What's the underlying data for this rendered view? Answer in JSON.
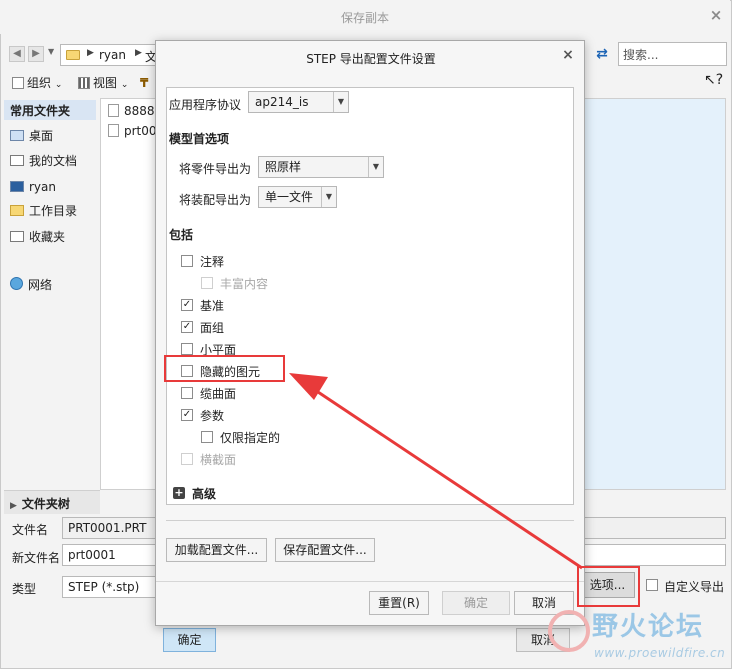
{
  "background_window": {
    "title": "保存副本",
    "close_glyph": "×",
    "address": {
      "user": "ryan",
      "partial": "文"
    },
    "search_placeholder": "搜索...",
    "toolbar": {
      "organize": "组织",
      "view": "视图"
    },
    "sidebar": {
      "header": "常用文件夹",
      "items": [
        {
          "label": "桌面",
          "icon": "desktop-icon"
        },
        {
          "label": "我的文档",
          "icon": "documents-icon"
        },
        {
          "label": "ryan",
          "icon": "computer-icon"
        },
        {
          "label": "工作目录",
          "icon": "working-directory-icon"
        },
        {
          "label": "收藏夹",
          "icon": "favorites-icon"
        },
        {
          "label": "网络",
          "icon": "network-icon"
        }
      ]
    },
    "files": [
      "8888",
      "prt00"
    ],
    "folder_tree": "文件夹树",
    "form": {
      "filename_label": "文件名",
      "filename_value": "PRT0001.PRT",
      "newname_label": "新文件名",
      "newname_value": "prt0001",
      "type_label": "类型",
      "type_value": "STEP (*.stp)"
    },
    "ok_button": "确定",
    "cancel_button": "取消",
    "options_button": "选项...",
    "custom_export_label": "自定义导出"
  },
  "dialog": {
    "title": "STEP 导出配置文件设置",
    "close_glyph": "×",
    "protocol_label": "应用程序协议",
    "protocol_value": "ap214_is",
    "model_prefs_header": "模型首选项",
    "part_export_label": "将零件导出为",
    "part_export_value": "照原样",
    "assembly_export_label": "将装配导出为",
    "assembly_export_value": "单一文件",
    "include_header": "包括",
    "checkboxes": [
      {
        "label": "注释",
        "checked": false,
        "disabled": false
      },
      {
        "label": "丰富内容",
        "checked": false,
        "disabled": true
      },
      {
        "label": "基准",
        "checked": true,
        "disabled": false
      },
      {
        "label": "面组",
        "checked": true,
        "disabled": false
      },
      {
        "label": "小平面",
        "checked": false,
        "disabled": false
      },
      {
        "label": "隐藏的图元",
        "checked": false,
        "disabled": false
      },
      {
        "label": "缆曲面",
        "checked": false,
        "disabled": false
      },
      {
        "label": "参数",
        "checked": true,
        "disabled": false
      },
      {
        "label": "仅限指定的",
        "checked": false,
        "disabled": false
      },
      {
        "label": "横截面",
        "checked": false,
        "disabled": true
      }
    ],
    "advanced_label": "高级",
    "load_config_button": "加载配置文件...",
    "save_config_button": "保存配置文件...",
    "reset_button": "重置(R)",
    "ok_button": "确定",
    "cancel_button": "取消"
  },
  "watermark": {
    "text": "野火论坛",
    "url": "www.proewildfire.cn"
  },
  "colors": {
    "highlight": "#e83a3a",
    "selection": "#cfe6f7"
  }
}
